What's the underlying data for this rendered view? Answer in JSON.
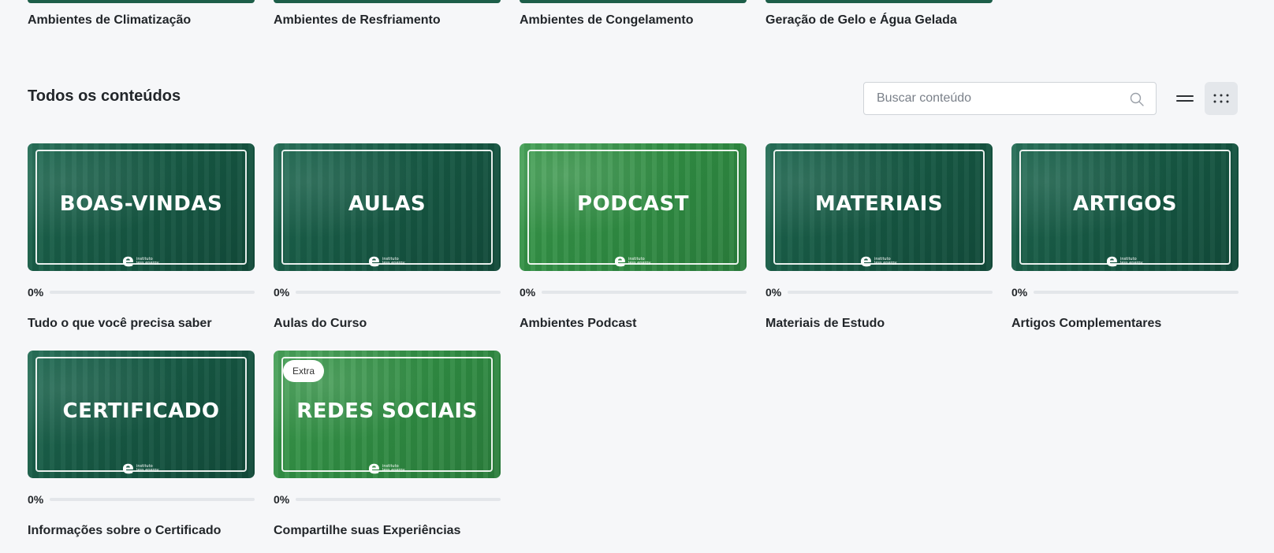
{
  "top_row": [
    {
      "title": "Ambientes de Climatização"
    },
    {
      "title": "Ambientes de Resfriamento"
    },
    {
      "title": "Ambientes de Congelamento"
    },
    {
      "title": "Geração de Gelo e Água Gelada"
    }
  ],
  "section": {
    "title": "Todos os conteúdos",
    "search_placeholder": "Buscar conteúdo",
    "search_value": ""
  },
  "view_toggle": {
    "list_icon": "list-icon",
    "grid_icon": "grid-icon",
    "selected": "grid"
  },
  "logo": {
    "mark": "e",
    "text": "instituto less energy"
  },
  "cards": [
    {
      "thumb_title": "BOAS-VINDAS",
      "progress_label": "0%",
      "progress": 0,
      "title": "Tudo o que você precisa saber",
      "theme": "dark",
      "badge": ""
    },
    {
      "thumb_title": "AULAS",
      "progress_label": "0%",
      "progress": 0,
      "title": "Aulas do Curso",
      "theme": "dark",
      "badge": ""
    },
    {
      "thumb_title": "PODCAST",
      "progress_label": "0%",
      "progress": 0,
      "title": "Ambientes Podcast",
      "theme": "light",
      "badge": ""
    },
    {
      "thumb_title": "MATERIAIS",
      "progress_label": "0%",
      "progress": 0,
      "title": "Materiais de Estudo",
      "theme": "dark",
      "badge": ""
    },
    {
      "thumb_title": "ARTIGOS",
      "progress_label": "0%",
      "progress": 0,
      "title": "Artigos Complementares",
      "theme": "dark",
      "badge": ""
    },
    {
      "thumb_title": "CERTIFICADO",
      "progress_label": "0%",
      "progress": 0,
      "title": "Informações sobre o Certificado",
      "theme": "dark",
      "badge": ""
    },
    {
      "thumb_title": "REDES SOCIAIS",
      "progress_label": "0%",
      "progress": 0,
      "title": "Compartilhe suas Experiências",
      "theme": "light",
      "badge": "Extra"
    }
  ],
  "colors": {
    "brand_dark": "#1d5e49",
    "brand_light": "#2f8a42",
    "background": "#f6f7f9"
  }
}
